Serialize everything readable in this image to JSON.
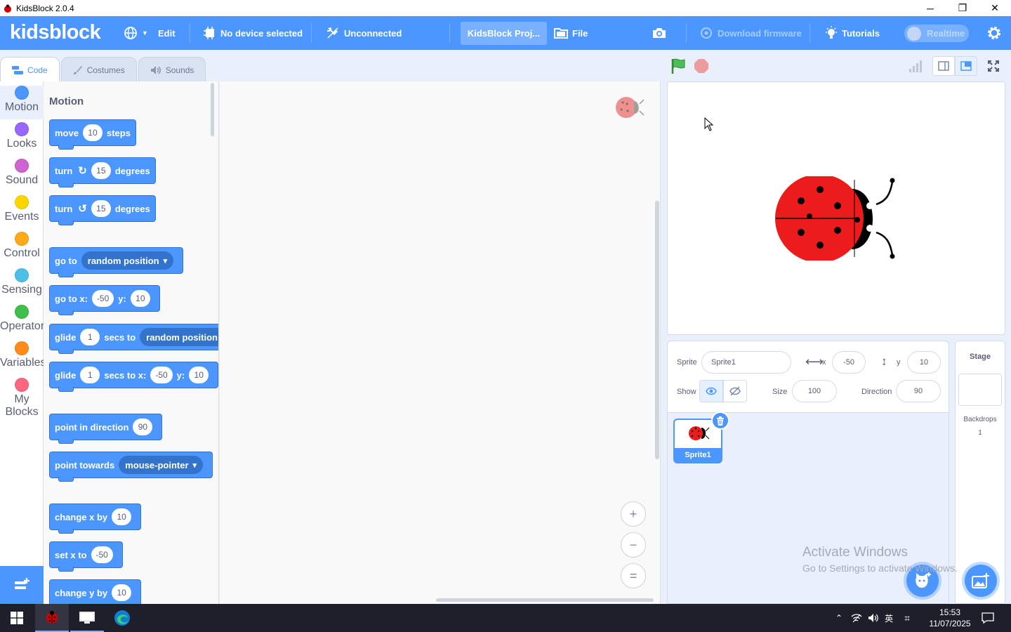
{
  "window": {
    "title": "KidsBlock 2.0.4",
    "minimize": "─",
    "maximize": "❐",
    "close": "✕"
  },
  "menubar": {
    "logo": "kidsblock",
    "edit": "Edit",
    "device": "No device selected",
    "connection": "Unconnected",
    "project_name": "KidsBlock Proj...",
    "file": "File",
    "download_firmware": "Download firmware",
    "tutorials": "Tutorials",
    "realtime": "Realtime"
  },
  "tabs": [
    {
      "label": "Code",
      "icon": "code-icon"
    },
    {
      "label": "Costumes",
      "icon": "brush-icon"
    },
    {
      "label": "Sounds",
      "icon": "speaker-icon"
    }
  ],
  "categories": [
    {
      "label": "Motion",
      "color": "#4c97ff"
    },
    {
      "label": "Looks",
      "color": "#9966ff"
    },
    {
      "label": "Sound",
      "color": "#cf63cf"
    },
    {
      "label": "Events",
      "color": "#ffd500"
    },
    {
      "label": "Control",
      "color": "#ffab19"
    },
    {
      "label": "Sensing",
      "color": "#4cbfe6"
    },
    {
      "label": "Operators",
      "color": "#40bf4a"
    },
    {
      "label": "Variables",
      "color": "#ff8c1a"
    },
    {
      "label": "My Blocks",
      "color": "#ff6680"
    }
  ],
  "palette": {
    "title": "Motion",
    "move": {
      "a": "move",
      "v": "10",
      "b": "steps"
    },
    "turn_cw": {
      "a": "turn",
      "v": "15",
      "b": "degrees"
    },
    "turn_ccw": {
      "a": "turn",
      "v": "15",
      "b": "degrees"
    },
    "goto": {
      "a": "go to",
      "dd": "random position"
    },
    "goto_xy": {
      "a": "go to x:",
      "x": "-50",
      "b": "y:",
      "y": "10"
    },
    "glide": {
      "a": "glide",
      "v": "1",
      "b": "secs to",
      "dd": "random position"
    },
    "glide_xy": {
      "a": "glide",
      "v": "1",
      "b": "secs to x:",
      "x": "-50",
      "c": "y:",
      "y": "10"
    },
    "point_dir": {
      "a": "point in direction",
      "v": "90"
    },
    "point_towards": {
      "a": "point towards",
      "dd": "mouse-pointer"
    },
    "change_x": {
      "a": "change x by",
      "v": "10"
    },
    "set_x": {
      "a": "set x to",
      "v": "-50"
    },
    "change_y": {
      "a": "change y by",
      "v": "10"
    }
  },
  "zoom": {
    "in": "+",
    "out": "−",
    "reset": "="
  },
  "sprite_info": {
    "sprite_label": "Sprite",
    "sprite_name": "Sprite1",
    "x_label": "x",
    "x": "-50",
    "y_label": "y",
    "y": "10",
    "show_label": "Show",
    "size_label": "Size",
    "size": "100",
    "direction_label": "Direction",
    "direction": "90"
  },
  "sprites": [
    {
      "name": "Sprite1"
    }
  ],
  "stage_pane": {
    "title": "Stage",
    "backdrops_label": "Backdrops",
    "backdrops_count": "1"
  },
  "watermark": {
    "line1": "Activate Windows",
    "line2": "Go to Settings to activate Windows."
  },
  "taskbar": {
    "time": "15:53",
    "date": "11/07/2025",
    "ime": "英"
  }
}
